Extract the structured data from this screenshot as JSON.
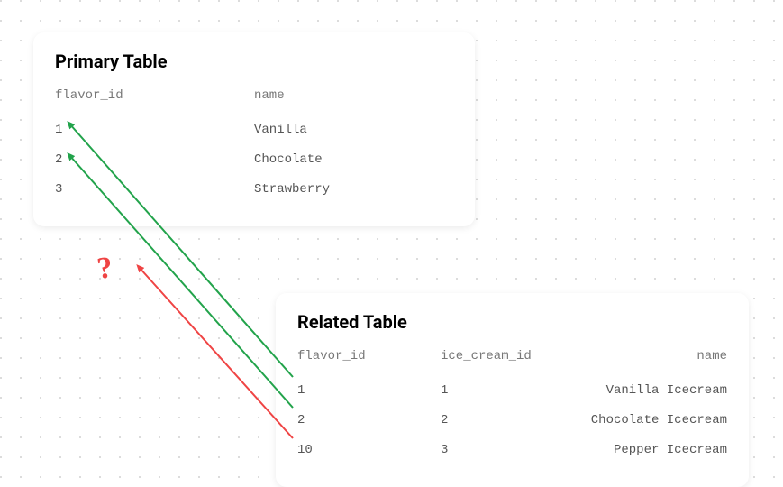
{
  "primary": {
    "title": "Primary Table",
    "columns": {
      "c0": "flavor_id",
      "c1": "name"
    },
    "rows": [
      {
        "c0": "1",
        "c1": "Vanilla"
      },
      {
        "c0": "2",
        "c1": "Chocolate"
      },
      {
        "c0": "3",
        "c1": "Strawberry"
      }
    ]
  },
  "related": {
    "title": "Related Table",
    "columns": {
      "c0": "flavor_id",
      "c1": "ice_cream_id",
      "c2": "name"
    },
    "rows": [
      {
        "c0": "1",
        "c1": "1",
        "c2": "Vanilla Icecream"
      },
      {
        "c0": "2",
        "c1": "2",
        "c2": "Chocolate Icecream"
      },
      {
        "c0": "10",
        "c1": "3",
        "c2": "Pepper Icecream"
      }
    ]
  },
  "question_mark": "?",
  "arrows": {
    "valid_color": "#22a34b",
    "invalid_color": "#ef4444"
  }
}
